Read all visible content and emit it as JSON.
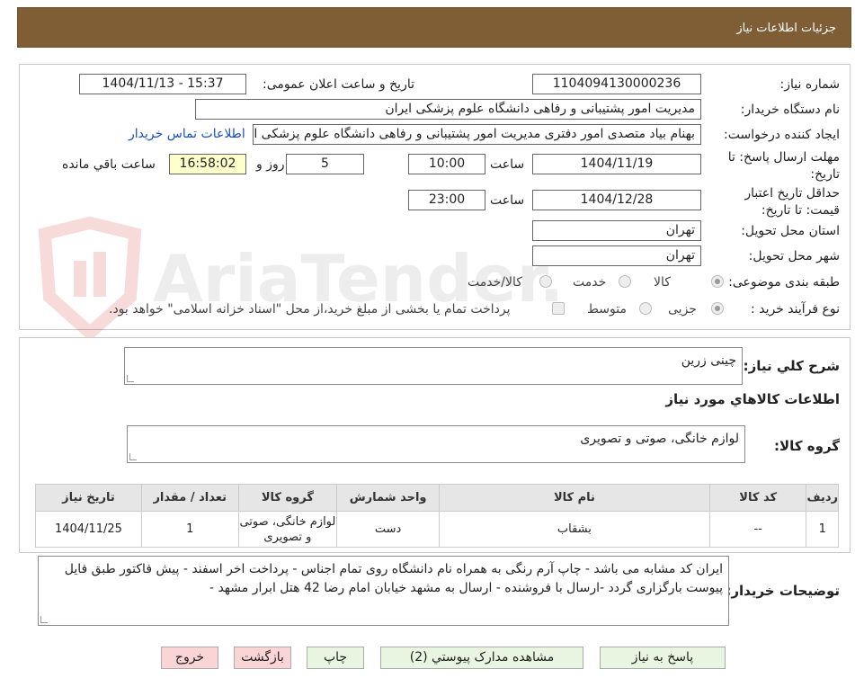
{
  "header": {
    "title": "جزئیات اطلاعات نیاز"
  },
  "form": {
    "need_number_label": "شماره نیاز:",
    "need_number": "1104094130000236",
    "announce_label": "تاریخ و ساعت اعلان عمومی:",
    "announce_value": "1404/11/13 - 15:37",
    "buyer_org_label": "نام دستگاه خریدار:",
    "buyer_org": "مدیریت امور پشتیبانی و رفاهی دانشگاه علوم پزشکی ایران",
    "creator_label": "ایجاد کننده درخواست:",
    "creator": "بهنام بیاد متصدی امور دفتری مدیریت امور پشتیبانی و رفاهی دانشگاه علوم پزشکی ایران",
    "contact_link": "اطلاعات تماس خریدار",
    "reply_deadline_label": "مهلت ارسال پاسخ: تا تاریخ:",
    "reply_date": "1404/11/19",
    "time_label": "ساعت",
    "reply_time": "10:00",
    "days": "5",
    "days_label": "روز و",
    "remaining_time": "16:58:02",
    "remaining_label": "ساعت باقي مانده",
    "validity_label": "حداقل تاریخ اعتبار قیمت: تا تاریخ:",
    "validity_date": "1404/12/28",
    "validity_time": "23:00",
    "province_label": "استان محل تحویل:",
    "province": "تهران",
    "city_label": "شهر محل تحویل:",
    "city": "تهران",
    "category_label": "طبقه بندی موضوعی:",
    "category_goods": "کالا",
    "category_service": "خدمت",
    "category_both": "کالا/خدمت",
    "process_label": "نوع فرآیند خرید :",
    "process_partial": "جزیی",
    "process_medium": "متوسط",
    "treasury_note": "پرداخت تمام یا بخشی از مبلغ خرید،از محل \"اسناد خزانه اسلامی\" خواهد بود."
  },
  "details": {
    "summary_label": "شرح كلي نياز:",
    "summary": "چینی زرین",
    "goods_info_title": "اطلاعات کالاهاي مورد نياز",
    "goods_group_label": "گروه کالا:",
    "goods_group": "لوازم خانگی، صوتی و تصویری",
    "table": {
      "headers": [
        "رديف",
        "کد کالا",
        "نام کالا",
        "واحد شمارش",
        "گروه کالا",
        "تعداد / مقدار",
        "تاريخ نياز"
      ],
      "rows": [
        [
          "1",
          "--",
          "بشقاب",
          "دست",
          "لوازم خانگی، صوتی و تصویری",
          "1",
          "1404/11/25"
        ]
      ]
    },
    "buyer_notes_label": "توضیحات خریدار:",
    "buyer_notes": "ایران کد مشابه می باشد - چاپ آرم رنگی به همراه نام دانشگاه روی تمام اجناس - پرداخت اخر اسفند - پیش فاکتور طبق فایل پیوست بارگزاری گردد -ارسال با فروشنده - ارسال به مشهد خیابان امام رضا 42 هتل ابرار مشهد -"
  },
  "buttons": {
    "reply": "پاسخ به نياز",
    "attachments": "مشاهده مدارک پیوستي (2)",
    "print": "چاپ",
    "back": "بازگشت",
    "exit": "خروج"
  },
  "watermark": {
    "text": "AriaTender.neT"
  },
  "colors": {
    "header_bg": "#7f5e35",
    "link": "#1a4fc4",
    "green_button": "#e8f5e0",
    "pink_button": "#fbd5d5",
    "highlight_box": "#ffffcc"
  }
}
